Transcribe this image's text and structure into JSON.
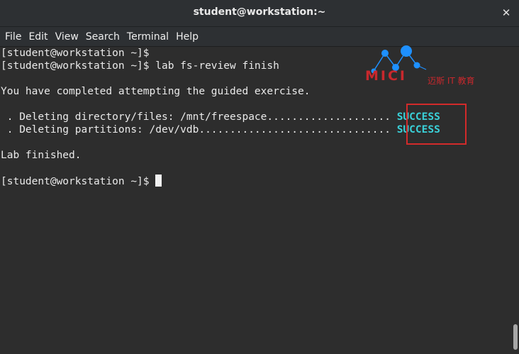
{
  "window": {
    "title": "student@workstation:~",
    "close_icon": "✕"
  },
  "menu": {
    "items": [
      "File",
      "Edit",
      "View",
      "Search",
      "Terminal",
      "Help"
    ]
  },
  "terminal": {
    "lines": [
      "[student@workstation ~]$",
      "[student@workstation ~]$ lab fs-review finish",
      "",
      "You have completed attempting the guided exercise.",
      "",
      " . Deleting directory/files: /mnt/freespace.................... ",
      " . Deleting partitions: /dev/vdb............................... ",
      "",
      "Lab finished.",
      "",
      "[student@workstation ~]$ "
    ],
    "status": [
      "SUCCESS",
      "SUCCESS"
    ]
  },
  "watermark": {
    "brand": "MICI",
    "subtitle": "迈斯 IT 教育"
  },
  "colors": {
    "background": "#2d2d2d",
    "text": "#eaeaea",
    "success": "#3ad0d8",
    "highlight": "#d22a2a",
    "watermark_red": "#c8282d",
    "watermark_blue": "#1e90ff"
  }
}
